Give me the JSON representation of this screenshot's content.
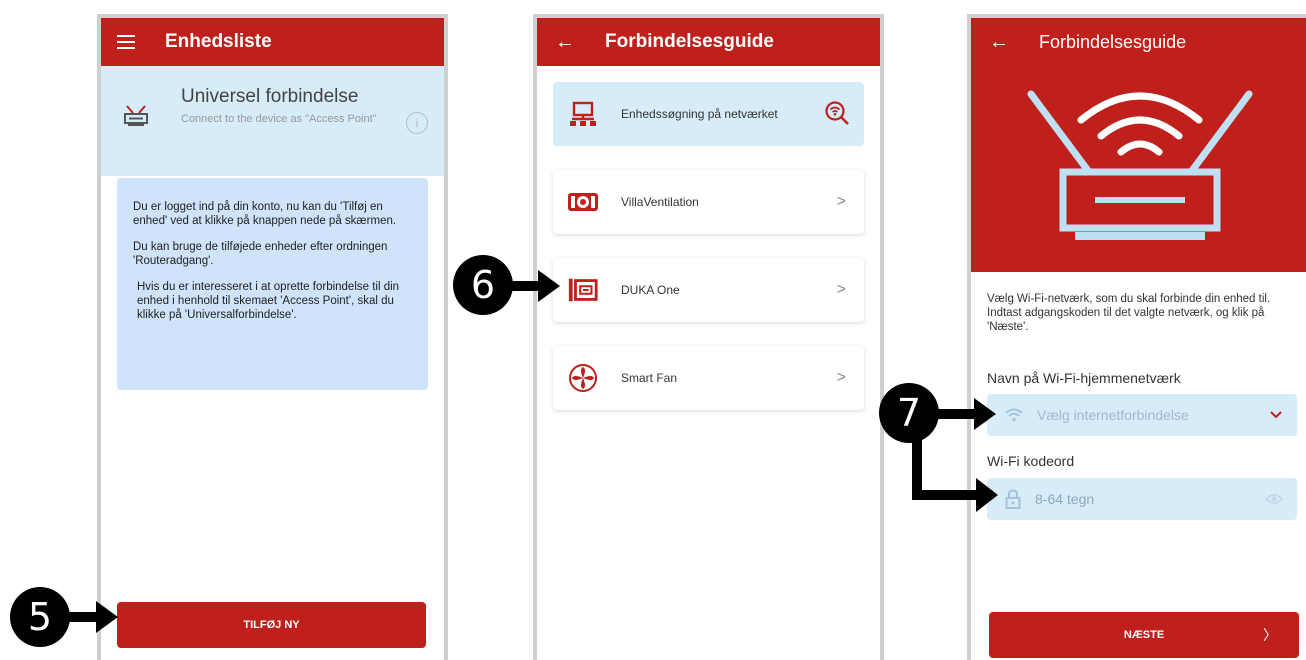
{
  "screen1": {
    "title": "Enhedsliste",
    "universal_title": "Universel forbindelse",
    "universal_subtitle": "Connect to the device as \"Access Point\"",
    "info_icon": "info-icon",
    "message_paragraphs": [
      "Du er logget ind på din konto, nu kan du 'Tilføj en enhed' ved at klikke på knappen nede på skærmen.",
      "Du kan bruge de tilføjede enheder efter ordningen 'Routeradgang'.",
      "Hvis du er interesseret i at oprette forbindelse til din enhed i henhold til skemaet 'Access Point', skal du klikke på 'Universalforbindelse'."
    ],
    "add_button": "TILFØJ NY"
  },
  "screen2": {
    "title": "Forbindelsesguide",
    "search_label": "Enhedssøgning på netværket",
    "devices": [
      "VillaVentilation",
      "DUKA One",
      "Smart Fan"
    ]
  },
  "screen3": {
    "title": "Forbindelsesguide",
    "description": "Vælg Wi-Fi-netværk, som du skal forbinde din enhed til. Indtast adgangskoden til det valgte netværk, og klik på 'Næste'.",
    "network_label": "Navn på Wi-Fi-hjemmenetværk",
    "network_placeholder": "Vælg internetforbindelse",
    "password_label": "Wi-Fi kodeord",
    "password_placeholder": "8-64 tegn",
    "next_button": "NÆSTE",
    "next_chevron": "〉"
  },
  "steps": [
    "5",
    "6",
    "7"
  ],
  "colors": {
    "brand_red": "#c0201b",
    "light_blue": "#d6ecf8",
    "message_blue": "#cfe3fa"
  }
}
